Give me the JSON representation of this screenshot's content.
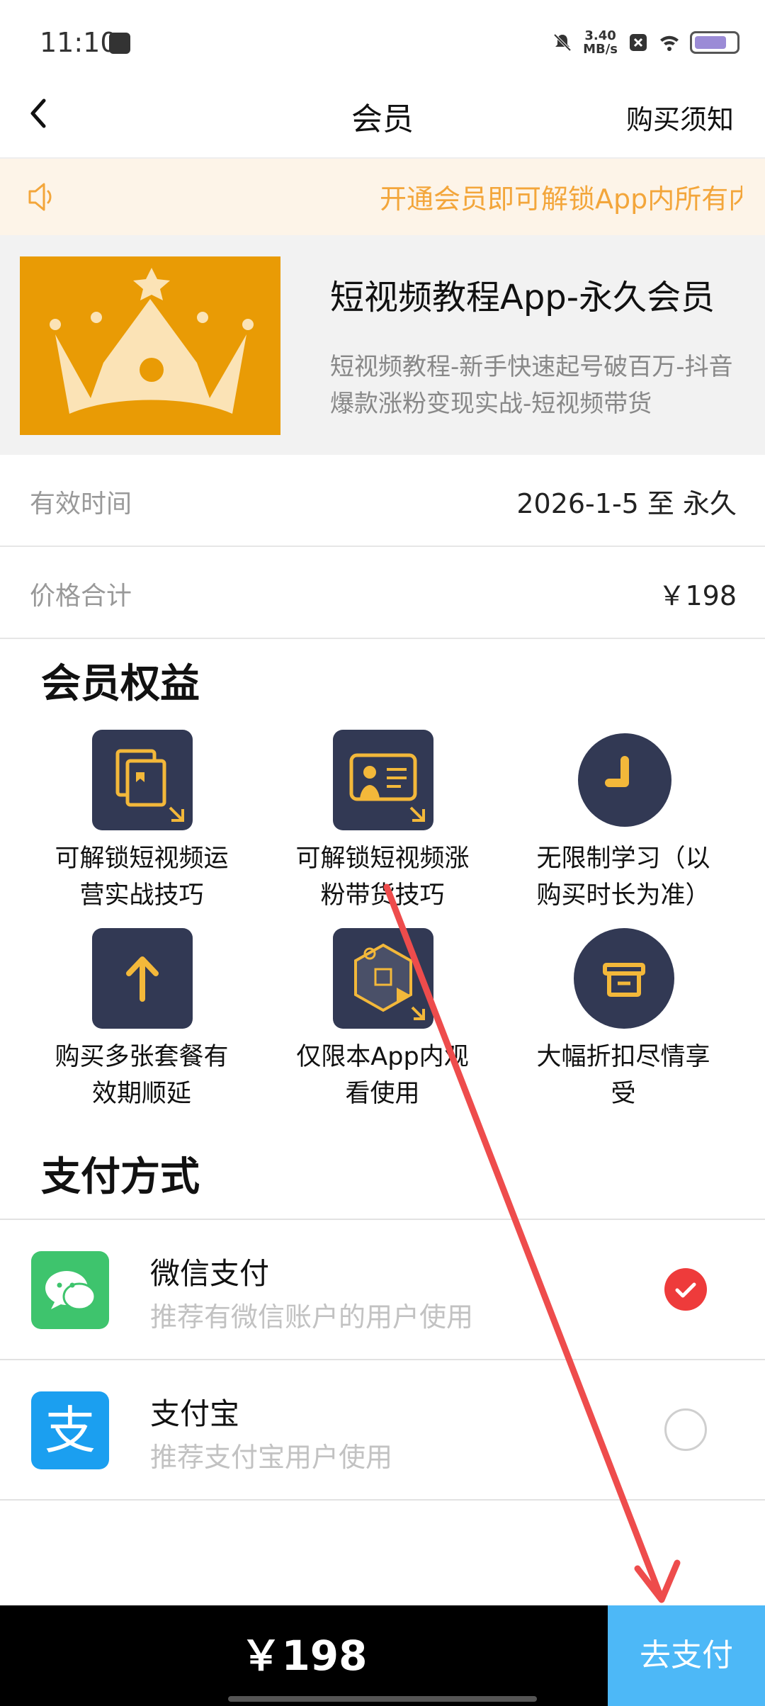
{
  "status_bar": {
    "time": "11:10",
    "net_speed": "3.40",
    "net_unit": "MB/s"
  },
  "header": {
    "title": "会员",
    "notice_link": "购买须知"
  },
  "marquee": {
    "text": "开通会员即可解锁App内所有内容"
  },
  "product": {
    "title": "短视频教程App-永久会员",
    "description_line1": "短视频教程-新手快速起号破百万-抖音",
    "description_line2": "爆款涨粉变现实战-短视频带货"
  },
  "info": {
    "validity_label": "有效时间",
    "validity_value": "2026-1-5 至 永久",
    "price_label": "价格合计",
    "price_value": "￥198"
  },
  "benefits": {
    "title": "会员权益",
    "items": [
      {
        "line1": "可解锁短视频运",
        "line2": "营实战技巧",
        "icon": "book-icon"
      },
      {
        "line1": "可解锁短视频涨",
        "line2": "粉带货技巧",
        "icon": "teacher-board-icon"
      },
      {
        "line1": "无限制学习（以",
        "line2": "购买时长为准）",
        "icon": "clock-icon"
      },
      {
        "line1": "购买多张套餐有",
        "line2": "效期顺延",
        "icon": "arrow-up-icon"
      },
      {
        "line1": "仅限本App内观",
        "line2": "看使用",
        "icon": "video-puzzle-icon"
      },
      {
        "line1": "大幅折扣尽情享",
        "line2": "受",
        "icon": "gift-box-icon"
      }
    ]
  },
  "payment": {
    "title": "支付方式",
    "methods": [
      {
        "name": "微信支付",
        "sub": "推荐有微信账户的用户使用",
        "selected": true,
        "color": "#3ec46d"
      },
      {
        "name": "支付宝",
        "sub": "推荐支付宝用户使用",
        "selected": false,
        "color": "#1b9ff0"
      }
    ]
  },
  "footer": {
    "total": "￥198",
    "pay_button": "去支付"
  },
  "colors": {
    "accent_orange": "#e99b05",
    "icon_navy": "#323954",
    "pay_blue": "#4db8f7",
    "select_red": "#ee3b3b"
  }
}
